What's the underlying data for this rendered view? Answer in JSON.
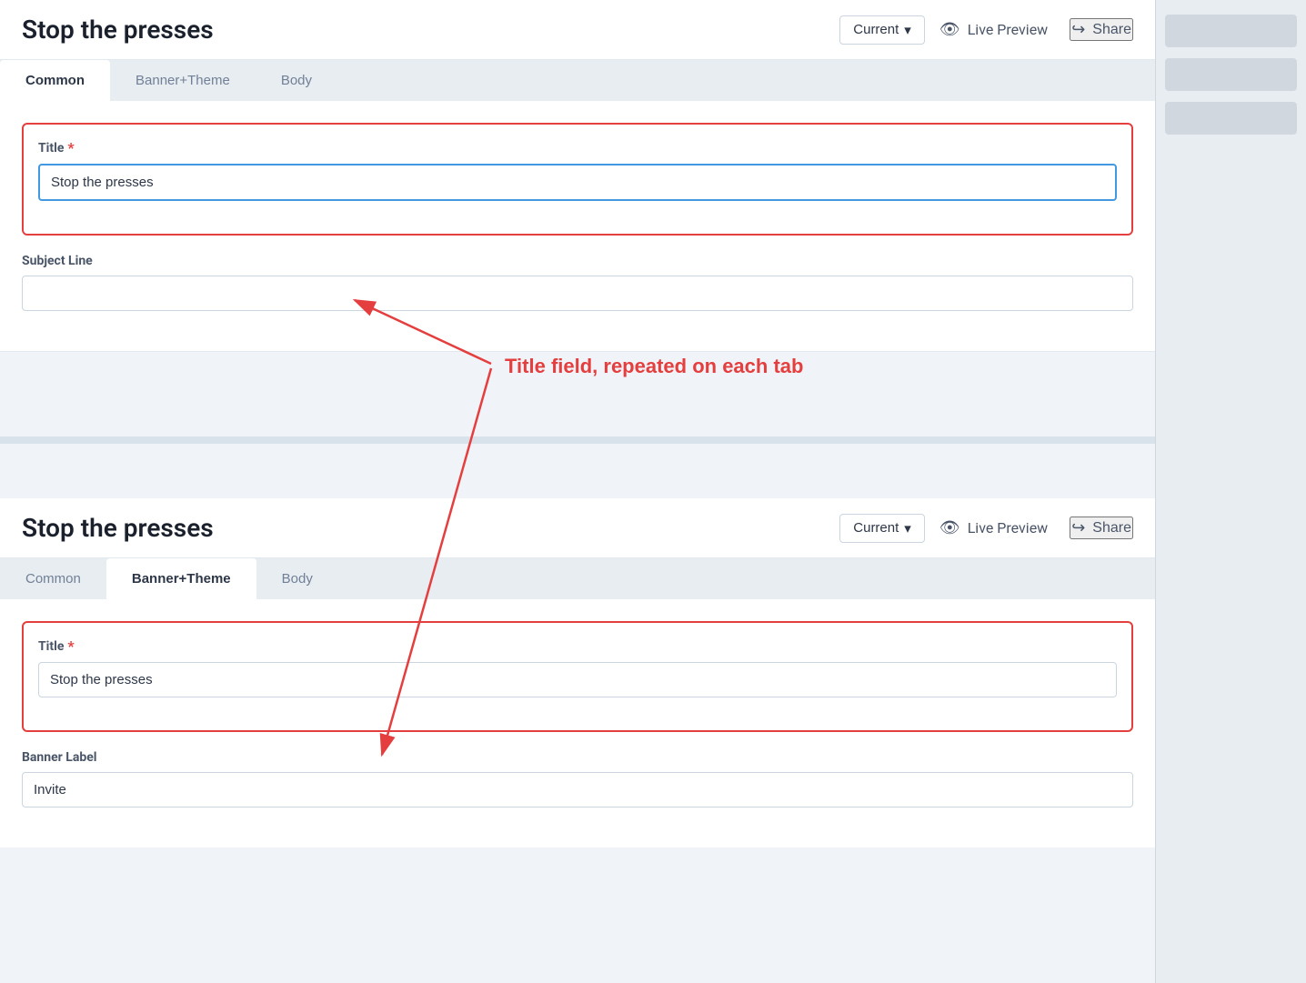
{
  "top_panel": {
    "title": "Stop the presses",
    "dropdown_label": "Current",
    "dropdown_icon": "▾",
    "live_preview_label": "Live Preview",
    "share_label": "Share",
    "tabs": [
      {
        "id": "common",
        "label": "Common",
        "active": true
      },
      {
        "id": "banner-theme",
        "label": "Banner+Theme",
        "active": false
      },
      {
        "id": "body",
        "label": "Body",
        "active": false
      }
    ],
    "fields": {
      "title_label": "Title",
      "title_required": "*",
      "title_value": "Stop the presses",
      "subject_line_label": "Subject Line",
      "subject_line_value": ""
    }
  },
  "bottom_panel": {
    "title": "Stop the presses",
    "dropdown_label": "Current",
    "dropdown_icon": "▾",
    "live_preview_label": "Live Preview",
    "share_label": "Share",
    "tabs": [
      {
        "id": "common",
        "label": "Common",
        "active": false
      },
      {
        "id": "banner-theme",
        "label": "Banner+Theme",
        "active": true
      },
      {
        "id": "body",
        "label": "Body",
        "active": false
      }
    ],
    "fields": {
      "title_label": "Title",
      "title_required": "*",
      "title_value": "Stop the presses",
      "banner_label_label": "Banner Label",
      "banner_label_value": "Invite"
    }
  },
  "annotation": {
    "text": "Title field, repeated on each tab"
  },
  "icons": {
    "eye": "👁",
    "share": "↪",
    "chevron_down": "∨"
  }
}
